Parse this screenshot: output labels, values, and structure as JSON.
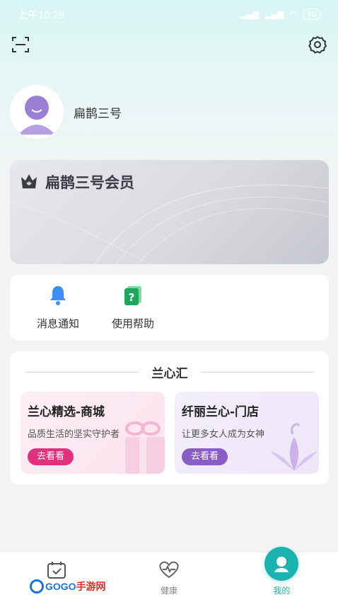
{
  "statusbar": {
    "time": "上午10:29",
    "battery": "80"
  },
  "topbar": {
    "scan_icon": "scan-icon",
    "settings_icon": "gear-icon"
  },
  "profile": {
    "username": "扁鹊三号"
  },
  "member": {
    "title": "扁鹊三号会员"
  },
  "quick_actions": [
    {
      "label": "消息通知",
      "icon": "bell-icon"
    },
    {
      "label": "使用帮助",
      "icon": "help-book-icon"
    }
  ],
  "section": {
    "title": "兰心汇",
    "cards": [
      {
        "title": "兰心精选-商城",
        "subtitle": "品质生活的坚实守护者",
        "button": "去看看",
        "color": "#e0307e"
      },
      {
        "title": "纤丽兰心-门店",
        "subtitle": "让更多女人成为女神",
        "button": "去看看",
        "color": "#8a5cc5"
      }
    ]
  },
  "tabbar": {
    "items": [
      {
        "label": "",
        "icon": "calendar-check-icon"
      },
      {
        "label": "健康",
        "icon": "heart-pulse-icon"
      },
      {
        "label": "我的",
        "icon": "user-icon",
        "active": true
      }
    ]
  },
  "watermark": {
    "text_en": "GOGO",
    "text_cn": "手游网"
  },
  "colors": {
    "accent": "#1bb3b0",
    "pink": "#e0307e",
    "purple": "#8a5cc5"
  }
}
